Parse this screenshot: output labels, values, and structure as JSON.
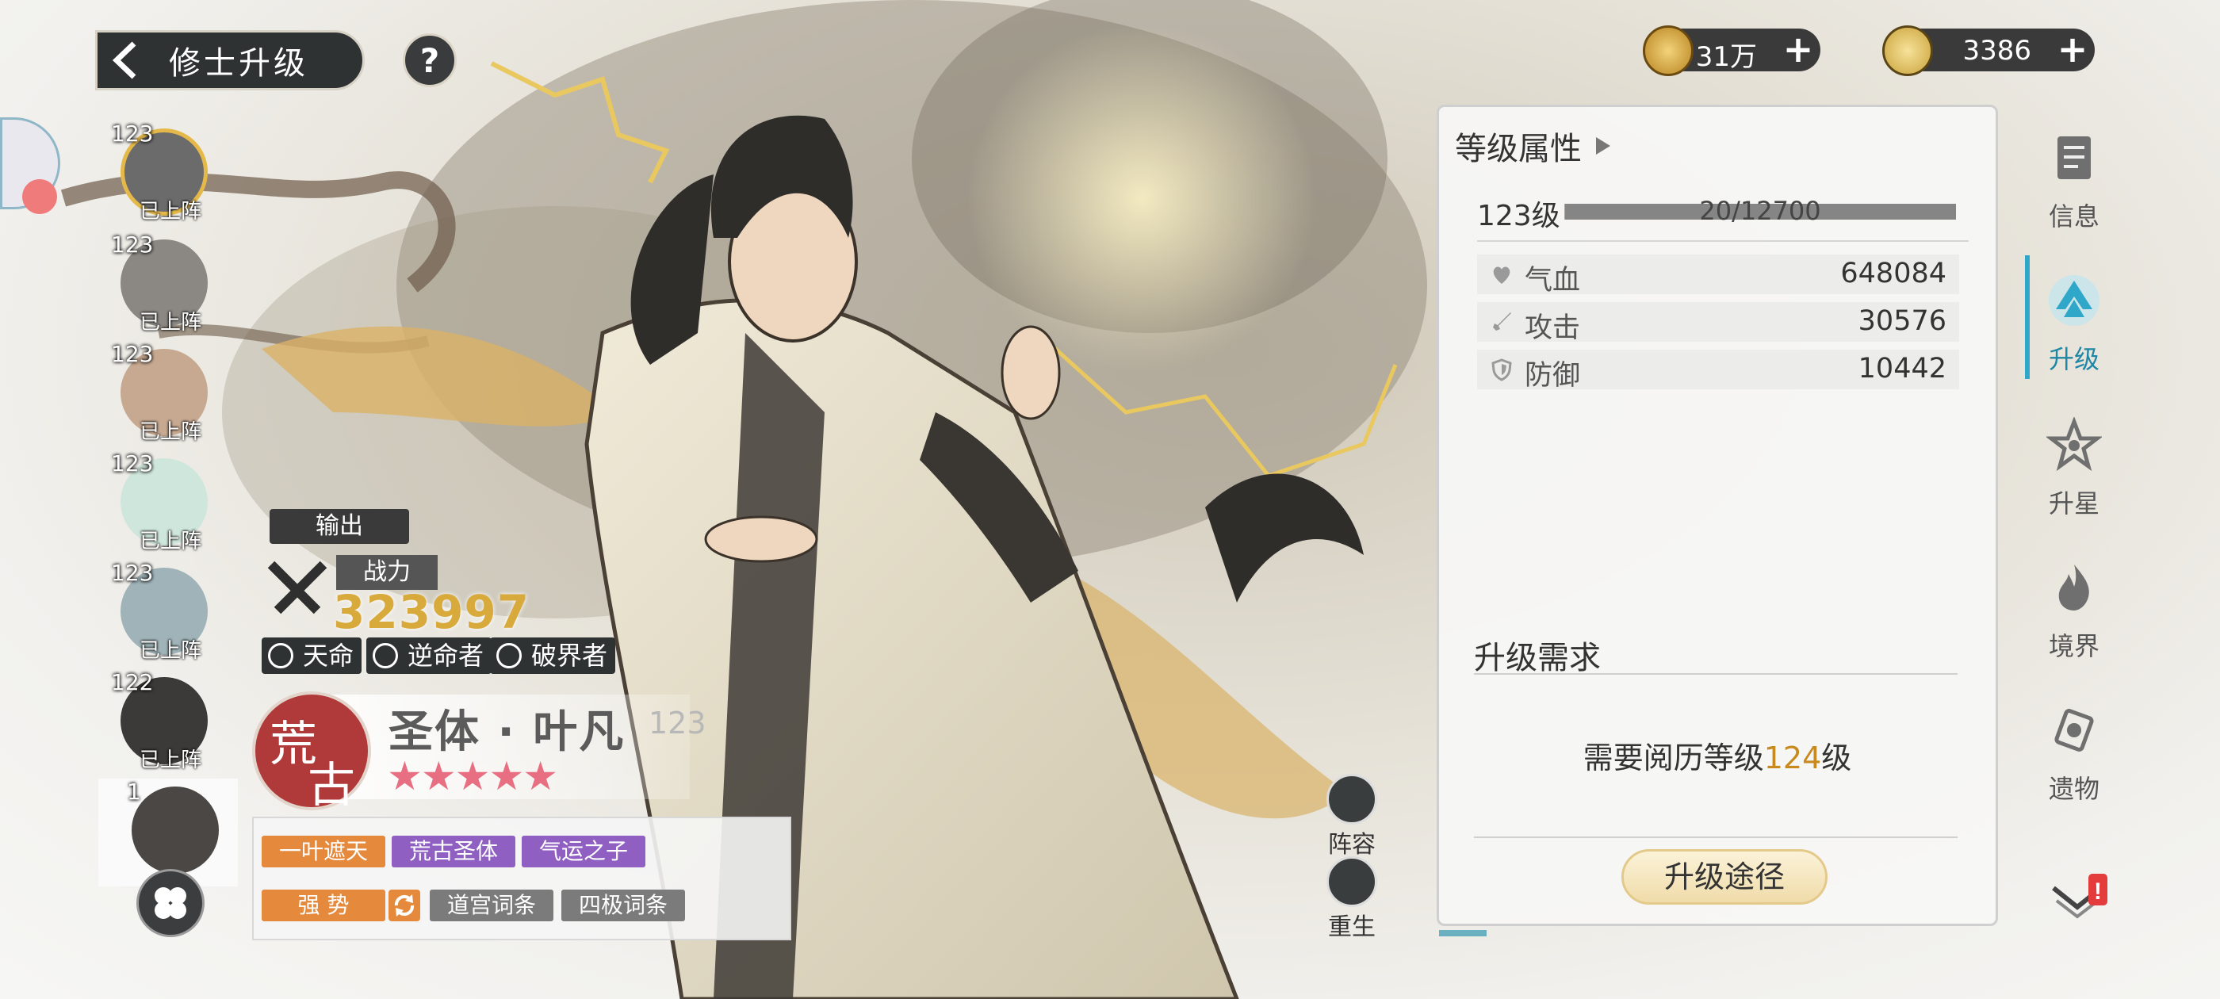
{
  "header": {
    "title": "修士升级",
    "help": "?"
  },
  "currency": [
    {
      "icon": "coin-icon",
      "value": "31万",
      "plus": "+"
    },
    {
      "icon": "spirit-stone-icon",
      "value": "3386",
      "plus": "+"
    }
  ],
  "panel": {
    "title": "等级属性",
    "level_label": "123级",
    "exp_text": "20/12700",
    "exp_progress": 0.0016,
    "stats": [
      {
        "icon": "heart-icon",
        "name": "气血",
        "value": "648084"
      },
      {
        "icon": "sword-icon",
        "name": "攻击",
        "value": "30576"
      },
      {
        "icon": "shield-icon",
        "name": "防御",
        "value": "10442"
      }
    ],
    "req_title": "升级需求",
    "req_prefix": "需要阅历等级",
    "req_level": "124",
    "req_suffix": "级",
    "upgrade_button": "升级途径"
  },
  "nav": [
    {
      "label": "信息",
      "icon": "document-icon",
      "active": false
    },
    {
      "label": "升级",
      "icon": "upgrade-icon",
      "active": true
    },
    {
      "label": "升星",
      "icon": "star-icon",
      "active": false
    },
    {
      "label": "境界",
      "icon": "flame-icon",
      "active": false
    },
    {
      "label": "遗物",
      "icon": "relic-icon",
      "active": false
    }
  ],
  "roster": [
    {
      "level": "123",
      "status": "已上阵"
    },
    {
      "level": "123",
      "status": "已上阵"
    },
    {
      "level": "123",
      "status": "已上阵"
    },
    {
      "level": "123",
      "status": "已上阵"
    },
    {
      "level": "123",
      "status": "已上阵"
    },
    {
      "level": "122",
      "status": "已上阵"
    },
    {
      "level": "1",
      "status": ""
    }
  ],
  "character": {
    "role": "输出",
    "power_label": "战力",
    "power_value": "323997",
    "tags": [
      "天命",
      "逆命者",
      "破界者"
    ],
    "faction_top": "荒",
    "faction_bottom": "古",
    "name": "圣体 · 叶凡",
    "level": "123",
    "stars": "★★★★★",
    "star_count": 5,
    "traits_row1": [
      "一叶遮天",
      "荒古圣体",
      "气运之子"
    ],
    "trait_strength": "强 势",
    "traits_row2": [
      "道宫词条",
      "四极词条"
    ]
  },
  "side_buttons": {
    "lineup": "阵容",
    "rebirth": "重生"
  },
  "colors": {
    "accent": "#2fa7c9",
    "gold": "#d8a93b",
    "orange": "#e58a3c",
    "purple": "#8f5fc2",
    "faction": "#b03a3a"
  }
}
